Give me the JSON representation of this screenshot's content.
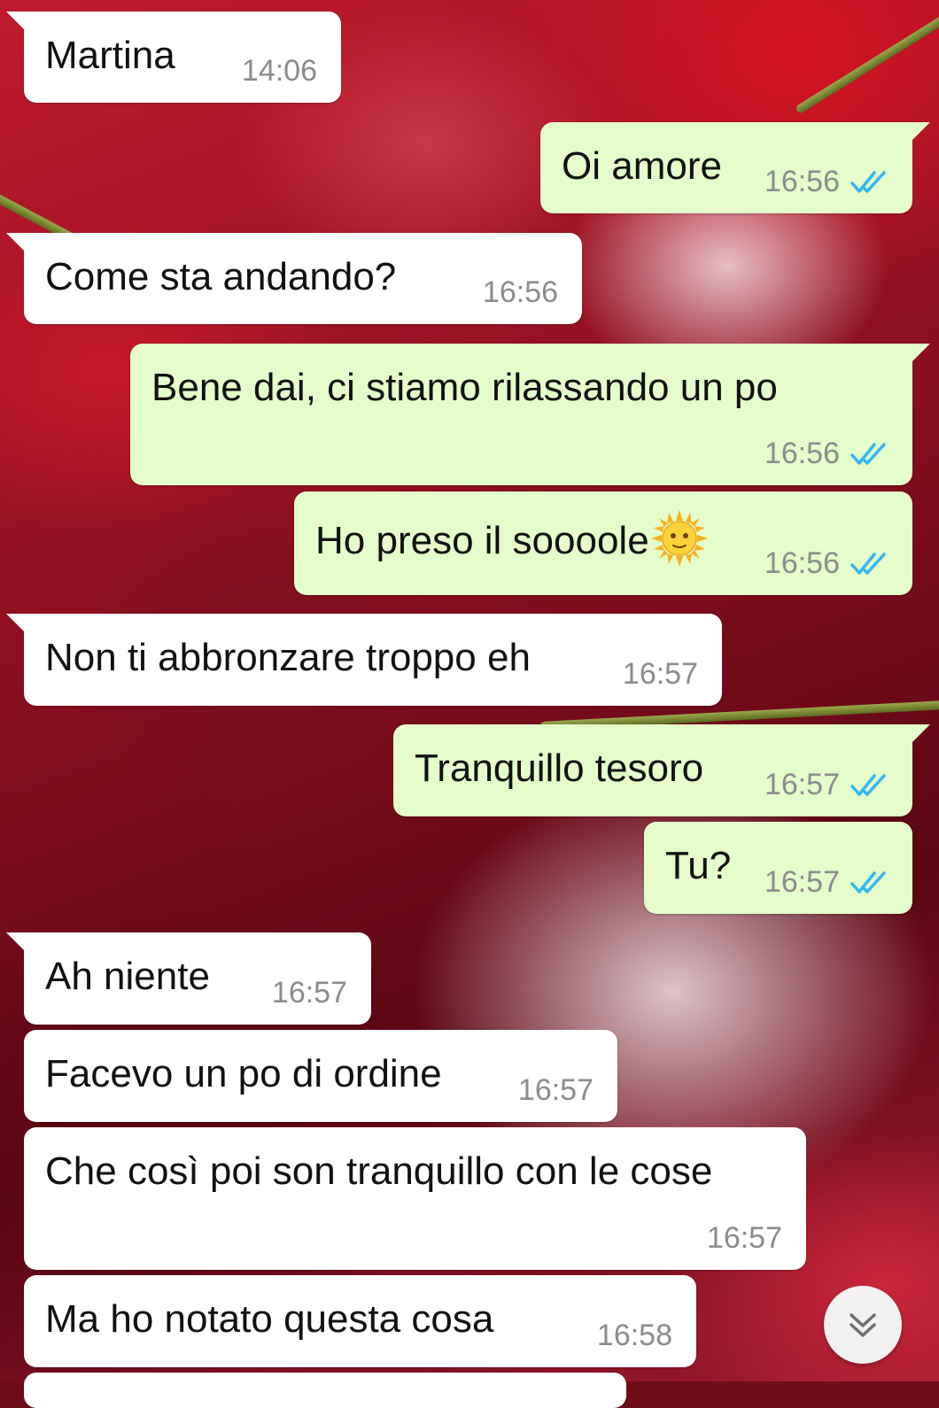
{
  "messages": [
    {
      "text": "Martina",
      "time": "14:06",
      "direction": "incoming",
      "status": ""
    },
    {
      "text": "Oi amore",
      "time": "16:56",
      "direction": "outgoing",
      "status": "read"
    },
    {
      "text": "Come sta andando?",
      "time": "16:56",
      "direction": "incoming",
      "status": ""
    },
    {
      "text": "Bene dai, ci stiamo rilassando un po",
      "time": "16:56",
      "direction": "outgoing",
      "status": "read"
    },
    {
      "text": "Ho preso il soooole",
      "emoji": "sun-with-face",
      "time": "16:56",
      "direction": "outgoing",
      "status": "read"
    },
    {
      "text": "Non ti abbronzare troppo eh",
      "time": "16:57",
      "direction": "incoming",
      "status": ""
    },
    {
      "text": "Tranquillo tesoro",
      "time": "16:57",
      "direction": "outgoing",
      "status": "read"
    },
    {
      "text": "Tu?",
      "time": "16:57",
      "direction": "outgoing",
      "status": "read"
    },
    {
      "text": "Ah niente",
      "time": "16:57",
      "direction": "incoming",
      "status": ""
    },
    {
      "text": "Facevo un po di ordine",
      "time": "16:57",
      "direction": "incoming",
      "status": ""
    },
    {
      "text": "Che così poi son tranquillo con le cose",
      "time": "16:57",
      "direction": "incoming",
      "status": ""
    },
    {
      "text": "Ma ho notato questa cosa",
      "time": "16:58",
      "direction": "incoming",
      "status": ""
    }
  ],
  "colors": {
    "incoming_bubble": "#ffffff",
    "outgoing_bubble": "#e4fdca",
    "read_ticks": "#34b7f1",
    "timestamp": "#8c8c8c"
  },
  "icons": {
    "read_receipt": "double-check-icon",
    "scroll_down": "chevron-double-down-icon"
  }
}
